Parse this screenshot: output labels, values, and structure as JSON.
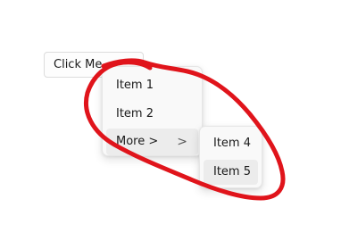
{
  "button": {
    "label": "Click Me"
  },
  "menu": {
    "items": [
      {
        "label": "Item 1"
      },
      {
        "label": "Item 2"
      },
      {
        "label": "More >"
      }
    ],
    "more_chevron": ">"
  },
  "submenu": {
    "items": [
      {
        "label": "Item 4"
      },
      {
        "label": "Item 5"
      }
    ]
  },
  "colors": {
    "annotation": "#e0141b",
    "hover": "#ececec",
    "menu_bg": "#f9f9f9"
  },
  "icons": [
    "chevron-right-icon"
  ]
}
